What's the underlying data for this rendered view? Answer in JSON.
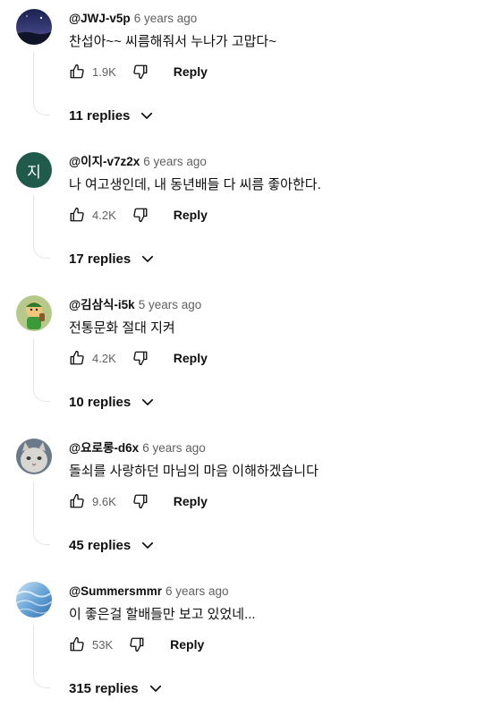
{
  "comments": [
    {
      "handle": "@JWJ-v5p",
      "time": "6 years ago",
      "text": "찬섭아~~ 씨름해줘서 누나가 고맙다~",
      "likes": "1.9K",
      "reply_label": "Reply",
      "replies": "11 replies",
      "avatar_icon": "night-sky-avatar"
    },
    {
      "handle": "@이지-v7z2x",
      "time": "6 years ago",
      "text": "나 여고생인데, 내 동년배들 다 씨름 좋아한다.",
      "likes": "4.2K",
      "reply_label": "Reply",
      "replies": "17 replies",
      "avatar_letter": "지",
      "avatar_color": "#1f5a4a"
    },
    {
      "handle": "@김삼식-i5k",
      "time": "5 years ago",
      "text": "전통문화 절대 지켜",
      "likes": "4.2K",
      "reply_label": "Reply",
      "replies": "10 replies",
      "avatar_icon": "cartoon-character-avatar"
    },
    {
      "handle": "@요로롱-d6x",
      "time": "6 years ago",
      "text": "돌쇠를 사랑하던 마님의 마음 이해하겠습니다",
      "likes": "9.6K",
      "reply_label": "Reply",
      "replies": "45 replies",
      "avatar_icon": "cat-avatar"
    },
    {
      "handle": "@Summersmmr",
      "time": "6 years ago",
      "text": "이 좋은걸 할배들만 보고 있었네...",
      "likes": "53K",
      "reply_label": "Reply",
      "replies": "315 replies",
      "avatar_icon": "water-avatar"
    }
  ],
  "icons": {
    "like": "thumb-up-icon",
    "dislike": "thumb-down-icon",
    "expand": "chevron-down-icon"
  }
}
